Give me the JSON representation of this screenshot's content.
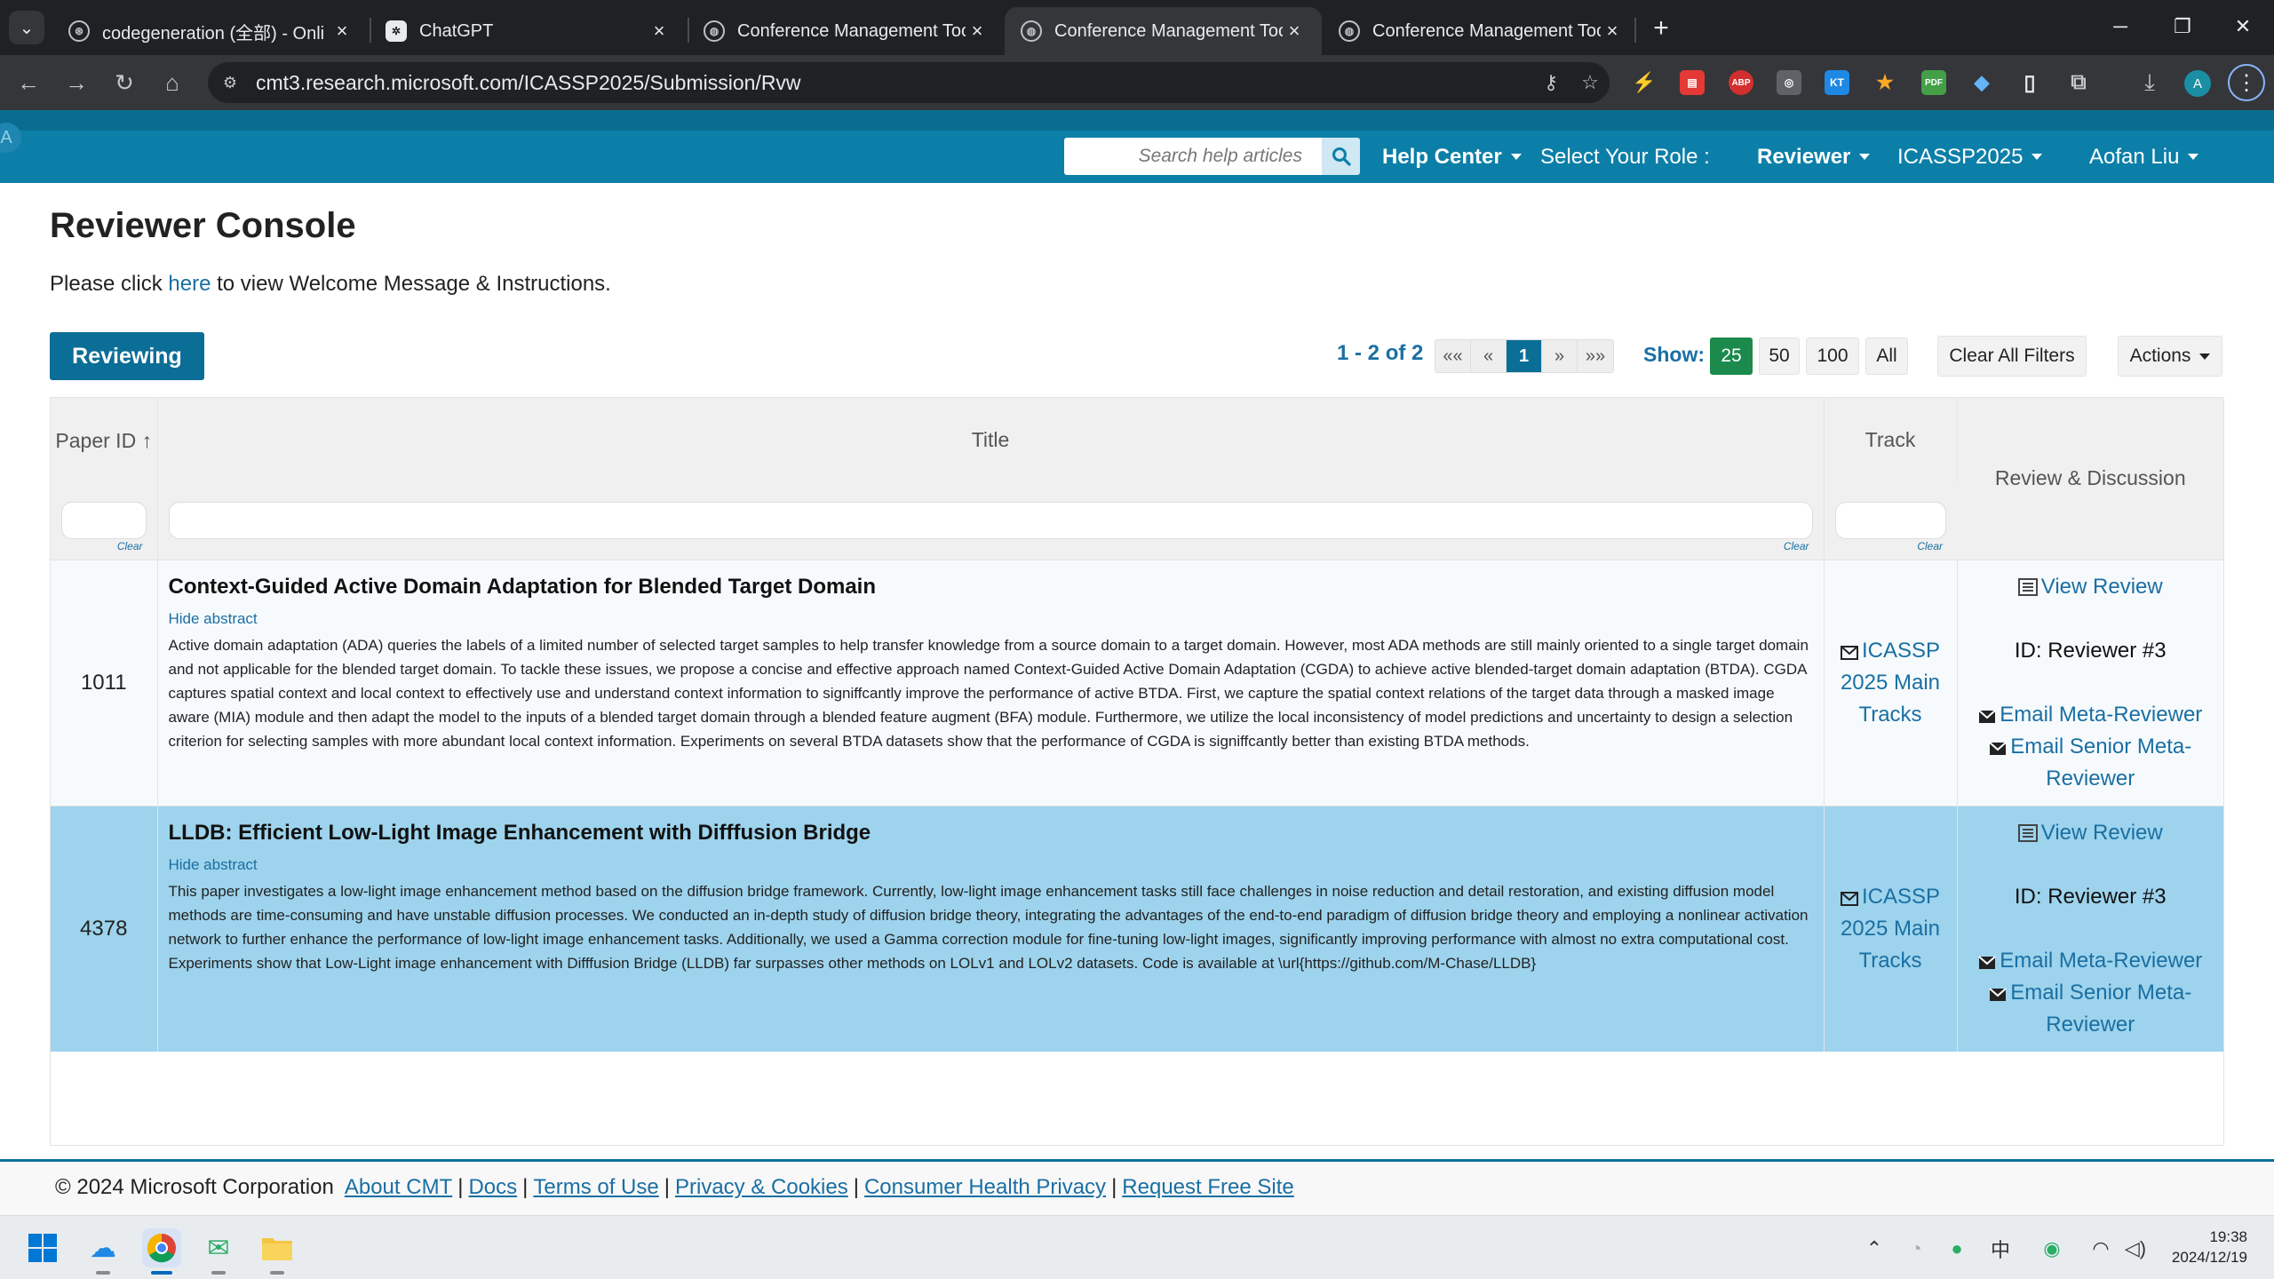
{
  "browser": {
    "tabs": [
      {
        "label": "codegeneration (全部) - Onli",
        "favicon": "openai-swirl-icon"
      },
      {
        "label": "ChatGPT",
        "favicon": "chatgpt-icon"
      },
      {
        "label": "Conference Management Too",
        "favicon": "globe-icon"
      },
      {
        "label": "Conference Management Too",
        "favicon": "globe-icon",
        "active": true
      },
      {
        "label": "Conference Management Too",
        "favicon": "globe-icon"
      }
    ],
    "url": "cmt3.research.microsoft.com/ICASSP2025/Submission/Rvw",
    "extensions": [
      {
        "name": "bolt-extension",
        "text": "⚡",
        "color": "#f9b800"
      },
      {
        "name": "red-note-extension",
        "text": "▤",
        "color": "#e53935"
      },
      {
        "name": "adblock-plus-extension",
        "text": "ABP",
        "color": "#d32f2f"
      },
      {
        "name": "glasses-extension",
        "text": "◎",
        "color": "#5f6368"
      },
      {
        "name": "kimi-extension",
        "text": "KT",
        "color": "#1e88e5"
      },
      {
        "name": "pikachu-extension",
        "text": "★",
        "color": "#f9a825"
      },
      {
        "name": "pdf-extension",
        "text": "PDF",
        "color": "#43a047"
      },
      {
        "name": "diamond-extension",
        "text": "◆",
        "color": "#1976d2"
      },
      {
        "name": "doc-extension",
        "text": "▯",
        "color": "#9aa0a6"
      },
      {
        "name": "puzzle-extension",
        "text": "⧉",
        "color": "#5f6368"
      }
    ],
    "profile_initial": "A"
  },
  "cmt_nav": {
    "corner_letter": "A",
    "search_placeholder": "Search help articles",
    "help_center": "Help Center",
    "select_role_label": "Select Your Role :",
    "role": "Reviewer",
    "conference": "ICASSP2025",
    "user": "Aofan Liu"
  },
  "page": {
    "title": "Reviewer Console",
    "intro_before": "Please click ",
    "intro_link": "here",
    "intro_after": " to view Welcome Message & Instructions.",
    "reviewing_button": "Reviewing"
  },
  "pagination": {
    "info": "1 - 2 of 2",
    "first": "««",
    "prev": "«",
    "current": "1",
    "next": "»",
    "last": "»»",
    "show_label": "Show:",
    "sizes": [
      "25",
      "50",
      "100",
      "All"
    ],
    "active_size": "25",
    "clear_all": "Clear All Filters",
    "actions": "Actions"
  },
  "table": {
    "columns": {
      "paper_id": "Paper ID",
      "sort_arrow": "↑",
      "title": "Title",
      "track": "Track",
      "review": "Review & Discussion"
    },
    "clear_label": "Clear",
    "rows": [
      {
        "id": "1011",
        "title": "Context-Guided Active Domain Adaptation for Blended Target Domain",
        "hide_abstract": "Hide abstract",
        "abstract": "Active domain adaptation (ADA) queries the labels of a limited number of selected target samples to help transfer knowledge from a source domain to a target domain. However, most ADA methods are still mainly oriented to a single target domain and not applicable for the blended target domain. To tackle these issues, we propose a concise and effective approach named Context-Guided Active Domain Adaptation (CGDA) to achieve active blended-target domain adaptation (BTDA). CGDA captures spatial context and local context to effectively use and understand context information to signiffcantly improve the performance of active BTDA. First, we capture the spatial context relations of the target data through a masked image aware (MIA) module and then adapt the model to the inputs of a blended target domain through a blended feature augment (BFA) module. Furthermore, we utilize the local inconsistency of model predictions and uncertainty to design a selection criterion for selecting samples with more abundant local context information. Experiments on several BTDA datasets show that the performance of CGDA is signiffcantly better than existing BTDA methods.",
        "track": "ICASSP 2025 Main Tracks",
        "view_review": "View Review",
        "reviewer_id": "ID: Reviewer #3",
        "email_meta": "Email Meta-Reviewer",
        "email_senior": "Email Senior Meta-Reviewer"
      },
      {
        "id": "4378",
        "title": "LLDB: Efficient Low-Light Image Enhancement with Difffusion Bridge",
        "hide_abstract": "Hide abstract",
        "abstract": "This paper investigates a low-light image enhancement method based on the diffusion bridge framework. Currently, low-light image enhancement tasks still face challenges in noise reduction and detail restoration, and existing diffusion model methods are time-consuming and have unstable diffusion processes. We conducted an in-depth study of diffusion bridge theory, integrating the advantages of the end-to-end paradigm of diffusion bridge theory and employing a nonlinear activation network to further enhance the performance of low-light image enhancement tasks. Additionally, we used a Gamma correction module for fine-tuning low-light images, significantly improving performance with almost no extra computational cost. Experiments show that Low-Light image enhancement with Difffusion Bridge (LLDB) far surpasses other methods on LOLv1 and LOLv2 datasets. Code is available at \\url{https://github.com/M-Chase/LLDB}",
        "track": "ICASSP 2025 Main Tracks",
        "view_review": "View Review",
        "reviewer_id": "ID: Reviewer #3",
        "email_meta": "Email Meta-Reviewer",
        "email_senior": "Email Senior Meta-Reviewer"
      }
    ]
  },
  "footer": {
    "copyright": "© 2024 Microsoft Corporation",
    "links": [
      "About CMT",
      "Docs",
      "Terms of Use",
      "Privacy & Cookies",
      "Consumer Health Privacy",
      "Request Free Site"
    ]
  },
  "taskbar": {
    "time": "19:38",
    "date": "2024/12/19",
    "ime": "中"
  },
  "colors": {
    "nav_teal": "#0c7fa8",
    "primary_button": "#0b6e96",
    "page_size_active": "#1c8a4c",
    "row_highlight": "#9dd3ec",
    "link": "#1a6fa3"
  }
}
